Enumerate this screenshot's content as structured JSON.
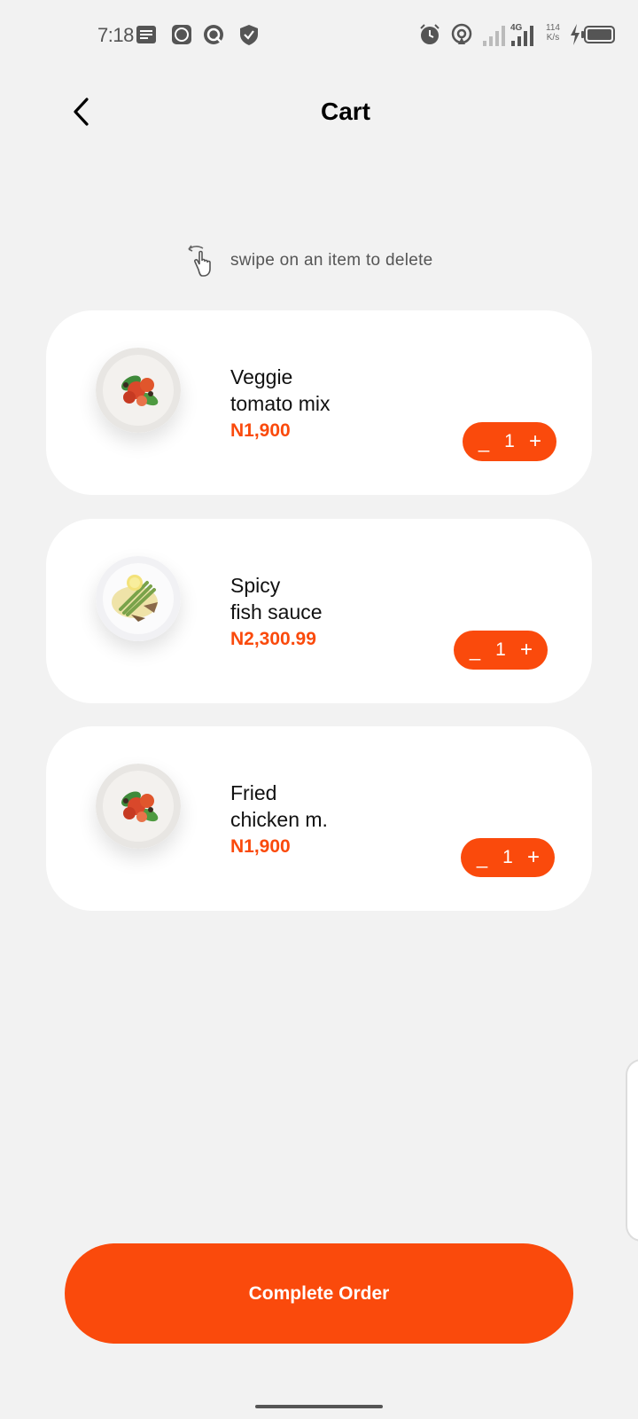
{
  "status_bar": {
    "time": "7:18",
    "speed_value": "114",
    "speed_unit": "K/s",
    "network": "4G",
    "left_icons": [
      "notes-icon",
      "b-app-icon",
      "q-app-icon",
      "shield-icon"
    ],
    "right_icons": [
      "alarm-icon",
      "hotspot-icon",
      "signal-empty-icon",
      "signal-4g-icon",
      "charging-icon",
      "battery-icon"
    ]
  },
  "header": {
    "title": "Cart"
  },
  "hint": {
    "text": "swipe on an item to delete",
    "icon": "swipe-hand-icon"
  },
  "cart": {
    "items": [
      {
        "name_line1": "Veggie",
        "name_line2": "tomato mix",
        "price": "N1,900",
        "quantity": "1",
        "image": "tomato-salad-plate"
      },
      {
        "name_line1": "Spicy",
        "name_line2": "fish sauce",
        "price": "N2,300.99",
        "quantity": "1",
        "image": "fish-salad-plate"
      },
      {
        "name_line1": "Fried",
        "name_line2": "chicken m.",
        "price": "N1,900",
        "quantity": "1",
        "image": "tomato-salad-plate"
      }
    ],
    "minus_label": "_",
    "plus_label": "+"
  },
  "actions": {
    "complete_order": "Complete Order"
  },
  "colors": {
    "accent": "#fa4a0c",
    "background": "#f2f2f2",
    "card": "#ffffff"
  }
}
